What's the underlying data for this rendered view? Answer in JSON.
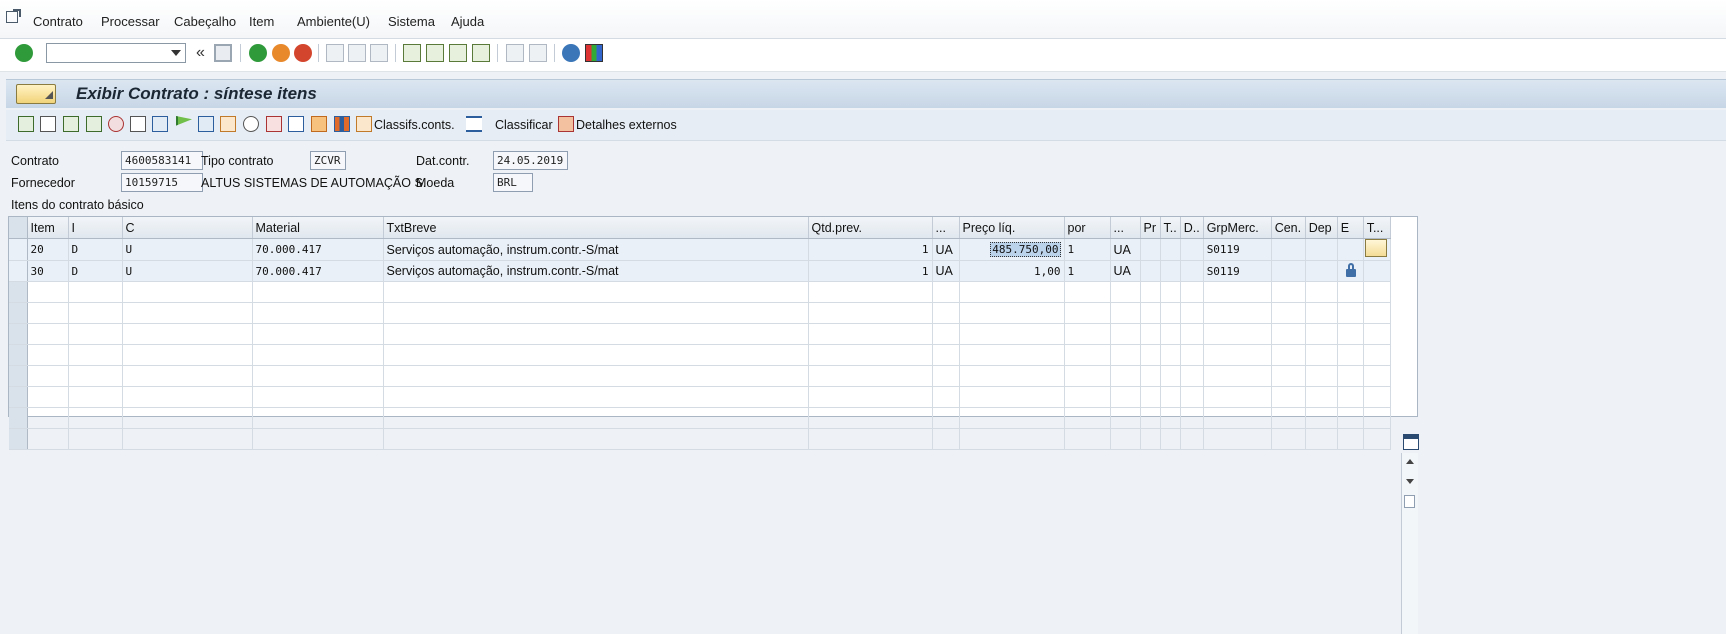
{
  "menu": {
    "items": [
      "Contrato",
      "Processar",
      "Cabeçalho",
      "Item",
      "Ambiente(U)",
      "Sistema",
      "Ajuda"
    ]
  },
  "toolbar": {
    "command_field_value": ""
  },
  "title": "Exibir Contrato : síntese itens",
  "app_toolbar": {
    "classifs_label": "Classifs.conts.",
    "classificar_label": "Classificar",
    "detalhes_label": "Detalhes externos"
  },
  "header": {
    "contrato_label": "Contrato",
    "contrato_value": "4600583141",
    "tipo_label": "Tipo contrato",
    "tipo_value": "ZCVR",
    "dat_label": "Dat.contr.",
    "dat_value": "24.05.2019",
    "fornecedor_label": "Fornecedor",
    "fornecedor_value": "10159715",
    "fornecedor_name": "ALTUS SISTEMAS DE AUTOMAÇÃO S.",
    "moeda_label": "Moeda",
    "moeda_value": "BRL"
  },
  "section_label": "Itens do contrato básico",
  "grid": {
    "columns": [
      "Item",
      "I",
      "C",
      "Material",
      "TxtBreve",
      "Qtd.prev.",
      "...",
      "Preço líq.",
      "por",
      "...",
      "Pr",
      "T..",
      "D..",
      "GrpMerc.",
      "Cen.",
      "Dep",
      "E",
      "T..."
    ],
    "rows": [
      {
        "item": "20",
        "i": "D",
        "c": "U",
        "material": "70.000.417",
        "txt": "Serviços automação, instrum.contr.-S/mat",
        "qtd": "1",
        "un": "UA",
        "preco": "485.750,00",
        "por": "1",
        "un2": "UA",
        "grp": "S0119"
      },
      {
        "item": "30",
        "i": "D",
        "c": "U",
        "material": "70.000.417",
        "txt": "Serviços automação, instrum.contr.-S/mat",
        "qtd": "1",
        "un": "UA",
        "preco": "1,00",
        "por": "1",
        "un2": "UA",
        "grp": "S0119"
      }
    ]
  },
  "colors": {
    "accent_green": "#2f9a3a",
    "title_bg": "#c7d6e6",
    "selection": "#bcd3ec"
  }
}
